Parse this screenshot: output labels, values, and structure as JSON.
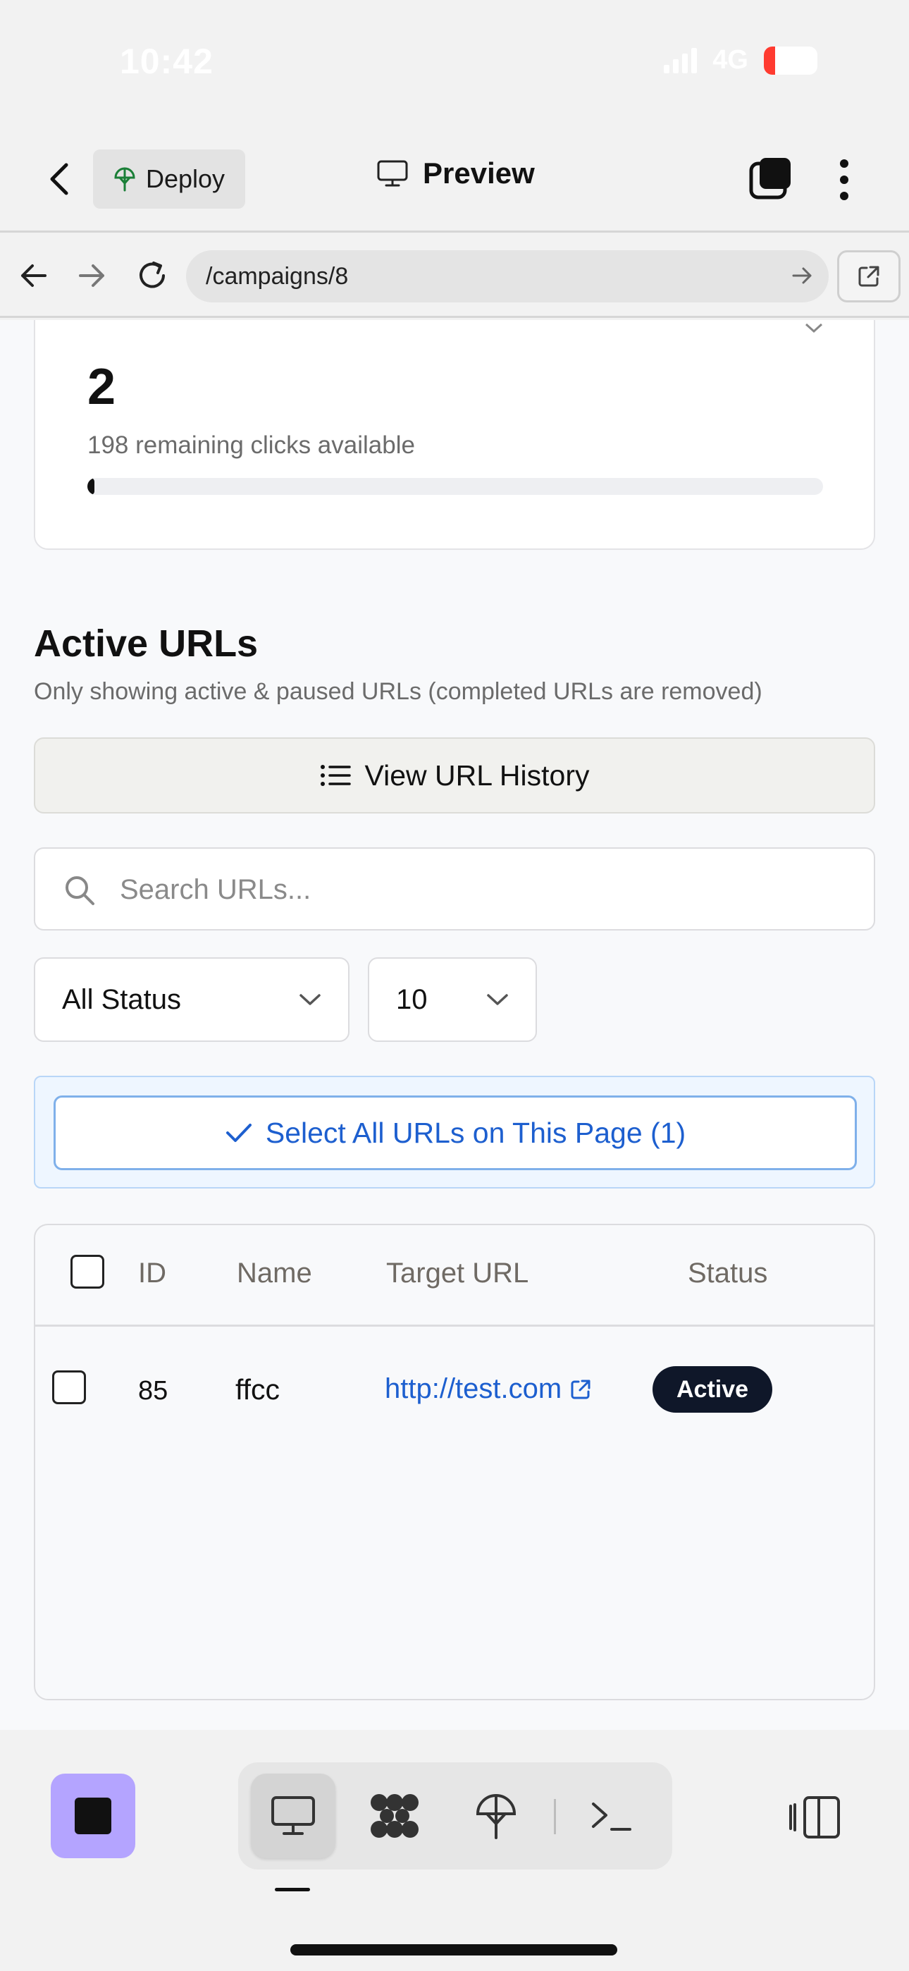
{
  "status_bar": {
    "time": "10:42",
    "network": "4G"
  },
  "app_bar": {
    "deploy_label": "Deploy",
    "title": "Preview"
  },
  "browser": {
    "url": "/campaigns/8"
  },
  "stats_card": {
    "value": "2",
    "subtitle": "198 remaining clicks available",
    "progress_fraction": 0.01
  },
  "section": {
    "title": "Active URLs",
    "subtitle": "Only showing active & paused URLs (completed URLs are removed)"
  },
  "history_button": {
    "label": "View URL History"
  },
  "search": {
    "placeholder": "Search URLs..."
  },
  "filters": {
    "status_selected": "All Status",
    "page_size_selected": "10"
  },
  "select_all": {
    "label": "Select All URLs on This Page (1)"
  },
  "table": {
    "headers": {
      "id": "ID",
      "name": "Name",
      "target_url": "Target URL",
      "status": "Status"
    },
    "rows": [
      {
        "id": "85",
        "name": "ffcc",
        "target_url": "http://test.com",
        "status": "Active"
      }
    ]
  },
  "colors": {
    "accent_blue": "#1d5fcf",
    "badge_bg": "#0f1729",
    "stop_button": "#b4a4ff"
  },
  "icons": [
    "back-chevron-icon",
    "deploy-globe-icon",
    "monitor-icon",
    "tabs-icon",
    "more-vertical-icon",
    "arrow-left-icon",
    "arrow-right-icon",
    "refresh-icon",
    "external-link-icon",
    "list-icon",
    "search-icon",
    "chevron-down-icon",
    "check-icon",
    "stop-icon",
    "desktop-icon",
    "apps-grid-icon",
    "deploy-icon",
    "terminal-icon",
    "panel-toggle-icon"
  ]
}
